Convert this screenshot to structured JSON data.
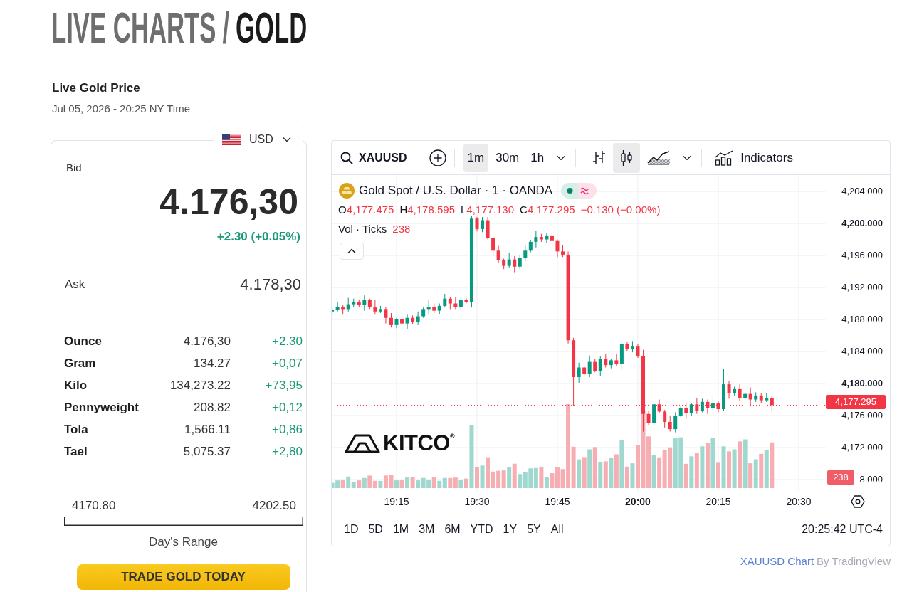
{
  "page_title": {
    "section": "LIVE CHARTS",
    "separator": "/",
    "current": "GOLD"
  },
  "quote": {
    "title": "Live Gold Price",
    "timestamp": "Jul 05, 2026 - 20:25 NY Time",
    "currency": "USD",
    "bid_label": "Bid",
    "bid": "4.176,30",
    "change": "+2.30 (+0.05%)",
    "change_rising": true,
    "ask_label": "Ask",
    "ask": "4.178,30",
    "units": [
      {
        "name": "Ounce",
        "price": "4.176,30",
        "change": "+2.30",
        "rising": true
      },
      {
        "name": "Gram",
        "price": "134.27",
        "change": "+0,07",
        "rising": true
      },
      {
        "name": "Kilo",
        "price": "134,273.22",
        "change": "+73,95",
        "rising": true
      },
      {
        "name": "Pennyweight",
        "price": "208.82",
        "change": "+0,12",
        "rising": true
      },
      {
        "name": "Tola",
        "price": "1,566.11",
        "change": "+0,86",
        "rising": true
      },
      {
        "name": "Tael",
        "price": "5,075.37",
        "change": "+2,80",
        "rising": true
      }
    ],
    "days_range": {
      "low": "4170.80",
      "high": "4202.50",
      "label": "Day's Range"
    },
    "cta": "TRADE GOLD TODAY"
  },
  "chart_widget": {
    "toolbar": {
      "symbol": "XAUUSD",
      "intervals": [
        {
          "label": "1m",
          "selected": true
        },
        {
          "label": "30m",
          "selected": false
        },
        {
          "label": "1h",
          "selected": false
        }
      ],
      "chart_styles": [
        {
          "kind": "bars",
          "selected": false
        },
        {
          "kind": "candles",
          "selected": true
        },
        {
          "kind": "area",
          "selected": false
        }
      ],
      "indicators": "Indicators"
    },
    "legend": {
      "title": "Gold Spot / U.S. Dollar · 1 · OANDA",
      "rising": false,
      "ohlc": [
        {
          "label": "O",
          "value": "4,177.475"
        },
        {
          "label": "H",
          "value": "4,178.595"
        },
        {
          "label": "L",
          "value": "4,177.130"
        },
        {
          "label": "C",
          "value": "4,177.295"
        }
      ],
      "change": "−0.130 (−0.00%)",
      "volume_label": "Vol · Ticks",
      "volume": "238"
    },
    "logo_text": "KITCO$^{®}$",
    "price_axis": [
      {
        "label": "4,204.000",
        "major": false
      },
      {
        "label": "4,200.000",
        "major": true
      },
      {
        "label": "4,196.000",
        "major": false
      },
      {
        "label": "4,192.000",
        "major": false
      },
      {
        "label": "4,188.000",
        "major": false
      },
      {
        "label": "4,184.000",
        "major": false
      },
      {
        "label": "4,180.000",
        "major": true
      },
      {
        "label": "4,176.000",
        "major": false
      },
      {
        "label": "4,172.000",
        "major": false
      },
      {
        "label": "8.000",
        "major": false
      }
    ],
    "last_price": "4,177.295",
    "last_volume": "238",
    "time_axis": [
      {
        "label": "19:15",
        "major": false
      },
      {
        "label": "19:30",
        "major": false
      },
      {
        "label": "19:45",
        "major": false
      },
      {
        "label": "20:00",
        "major": true
      },
      {
        "label": "20:15",
        "major": false
      },
      {
        "label": "20:30",
        "major": false
      }
    ],
    "ranges": [
      "1D",
      "5D",
      "1M",
      "3M",
      "6M",
      "YTD",
      "1Y",
      "5Y",
      "All"
    ],
    "clock": "20:25:42 UTC-4"
  },
  "attribution": {
    "link": "XAUUSD Chart",
    "text": "By TradingView"
  }
}
